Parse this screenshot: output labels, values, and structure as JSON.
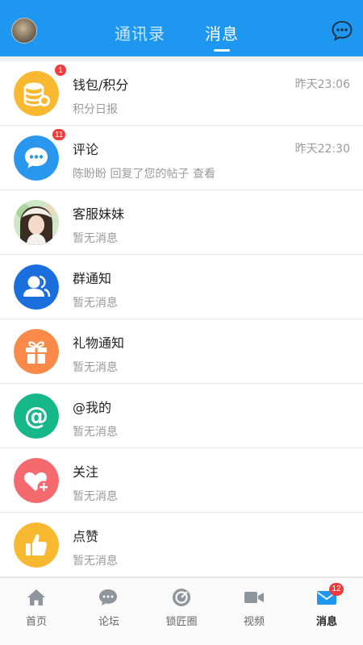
{
  "header": {
    "tabs": [
      {
        "label": "通讯录",
        "active": false
      },
      {
        "label": "消息",
        "active": true
      }
    ],
    "accent_color": "#1e97f0"
  },
  "messages": [
    {
      "title": "钱包/积分",
      "subtitle": "积分日报",
      "time": "昨天23:06",
      "badge": "1",
      "icon": "wallet-coins-icon",
      "color": "#f8b930"
    },
    {
      "title": "评论",
      "subtitle": "陈盼盼 回复了您的帖子   查看",
      "time": "昨天22:30",
      "badge": "11",
      "icon": "comment-bubble-icon",
      "color": "#2a97ef"
    },
    {
      "title": "客服妹妹",
      "subtitle": "暂无消息",
      "time": "",
      "badge": "",
      "icon": "customer-service-avatar",
      "color": ""
    },
    {
      "title": "群通知",
      "subtitle": "暂无消息",
      "time": "",
      "badge": "",
      "icon": "group-icon",
      "color": "#1a6fdd"
    },
    {
      "title": "礼物通知",
      "subtitle": "暂无消息",
      "time": "",
      "badge": "",
      "icon": "gift-icon",
      "color": "#fa8a4a"
    },
    {
      "title": "@我的",
      "subtitle": "暂无消息",
      "time": "",
      "badge": "",
      "icon": "at-icon",
      "color": "#16b88a"
    },
    {
      "title": "关注",
      "subtitle": "暂无消息",
      "time": "",
      "badge": "",
      "icon": "heart-plus-icon",
      "color": "#f56a6f"
    },
    {
      "title": "点赞",
      "subtitle": "暂无消息",
      "time": "",
      "badge": "",
      "icon": "thumbs-up-icon",
      "color": "#f8b930"
    }
  ],
  "bottom_nav": {
    "items": [
      {
        "label": "首页",
        "icon": "home-icon",
        "active": false
      },
      {
        "label": "论坛",
        "icon": "forum-icon",
        "active": false
      },
      {
        "label": "锁匠圈",
        "icon": "circle-target-icon",
        "active": false
      },
      {
        "label": "视频",
        "icon": "video-camera-icon",
        "active": false
      },
      {
        "label": "消息",
        "icon": "mail-icon",
        "active": true,
        "badge": "12"
      }
    ]
  }
}
